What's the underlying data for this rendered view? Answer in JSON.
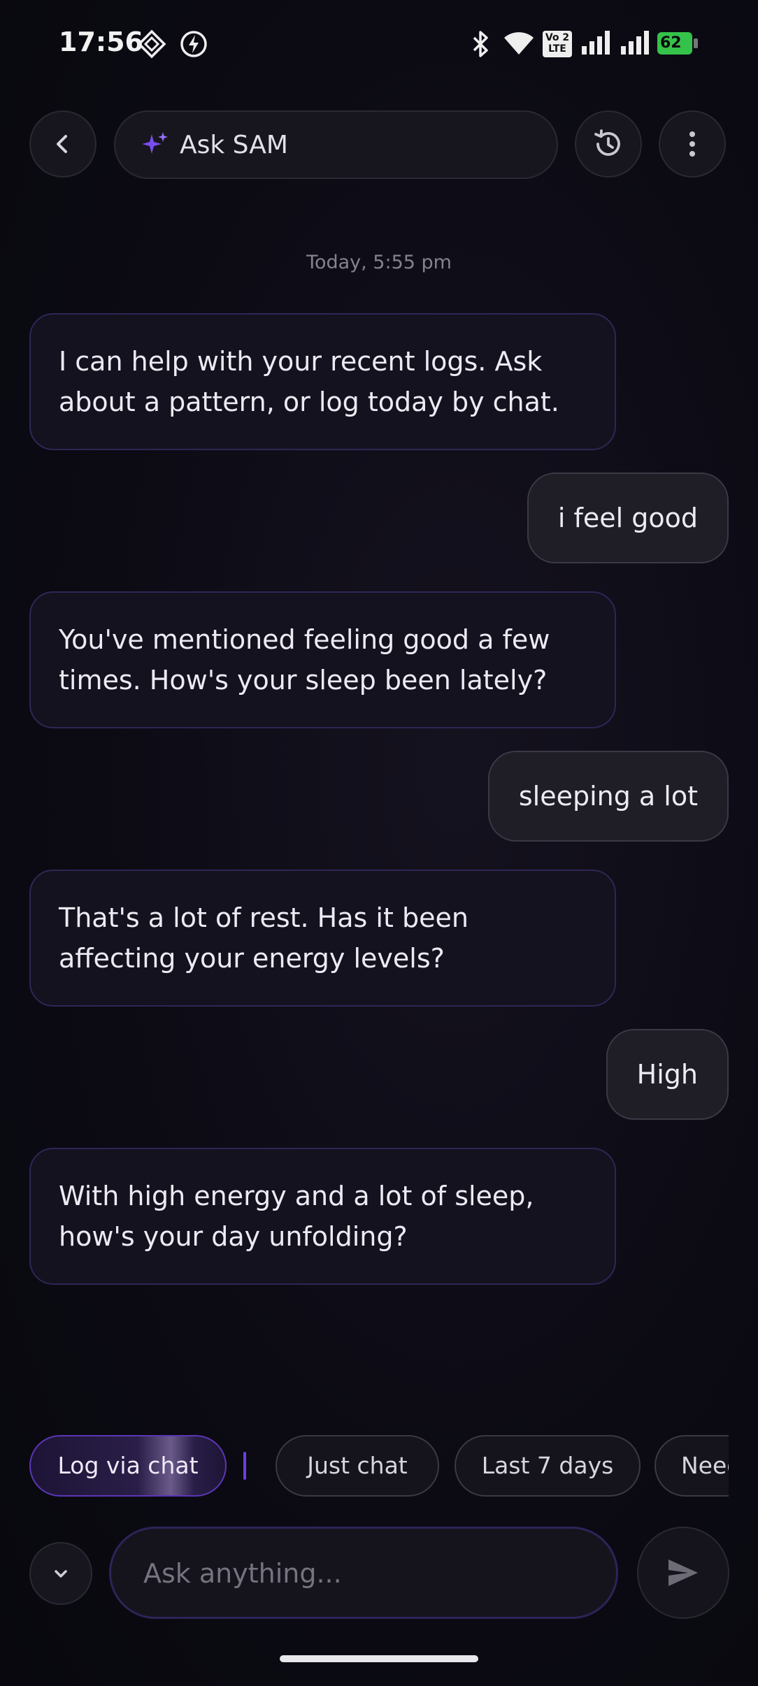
{
  "status_bar": {
    "time": "17:56",
    "icons": [
      "diamond-grid-icon",
      "charging-bolt-icon",
      "bluetooth-icon",
      "wifi-icon",
      "volte-icon",
      "signal-icon",
      "signal-icon"
    ],
    "volte_top": "Vo 2",
    "volte_bottom": "LTE",
    "battery": "62"
  },
  "header": {
    "back_icon": "chevron-left-icon",
    "sparkle_icon": "sparkle-icon",
    "title": "Ask SAM",
    "history_icon": "history-icon",
    "menu_icon": "more-vertical-icon"
  },
  "chat": {
    "timestamp": "Today, 5:55 pm",
    "messages": [
      {
        "role": "bot",
        "text": "I can help with your recent logs. Ask about a pattern, or log today by chat."
      },
      {
        "role": "user",
        "text": "i feel good"
      },
      {
        "role": "bot",
        "text": "You've mentioned feeling good a few times. How's your sleep been lately?"
      },
      {
        "role": "user",
        "text": "sleeping a lot"
      },
      {
        "role": "bot",
        "text": "That's a lot of rest. Has it been affecting your energy levels?"
      },
      {
        "role": "user",
        "text": "High"
      },
      {
        "role": "bot",
        "text": "With high energy and a lot of sleep, how's your day unfolding?"
      }
    ]
  },
  "chips": [
    "Log via chat",
    "Just chat",
    "Last 7 days",
    "Need"
  ],
  "composer": {
    "collapse_icon": "chevron-down-icon",
    "placeholder": "Ask anything...",
    "send_icon": "send-icon"
  },
  "colors": {
    "background": "#0c0b14",
    "bot_bubble_border": "#2f2656",
    "accent": "#6a3fe0",
    "battery": "#35c24a"
  }
}
